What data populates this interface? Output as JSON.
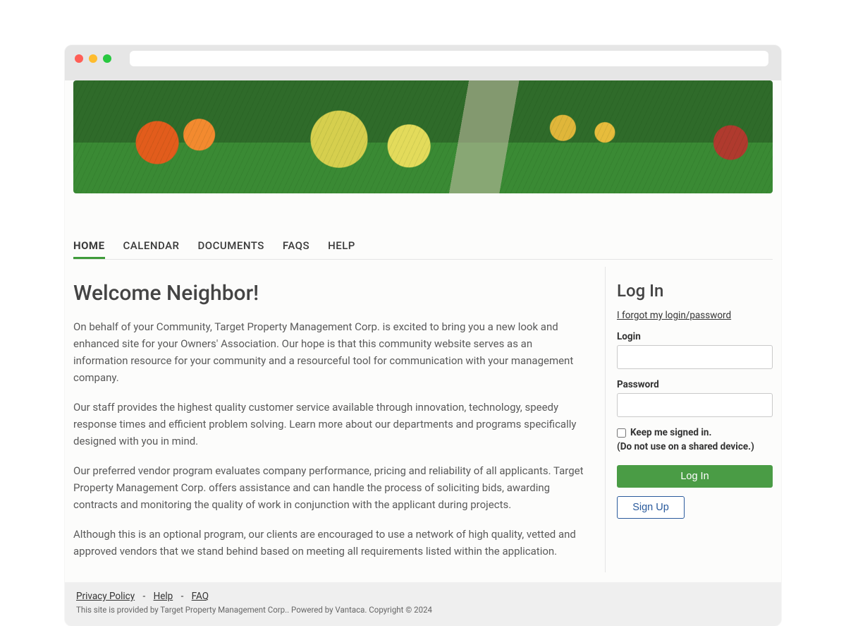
{
  "nav": {
    "items": [
      {
        "label": "HOME",
        "active": true
      },
      {
        "label": "CALENDAR",
        "active": false
      },
      {
        "label": "DOCUMENTS",
        "active": false
      },
      {
        "label": "FAQS",
        "active": false
      },
      {
        "label": "HELP",
        "active": false
      }
    ]
  },
  "main": {
    "heading": "Welcome Neighbor!",
    "paragraphs": [
      "On behalf of your Community, Target Property Management Corp. is excited to bring you a new look and enhanced site for your Owners' Association. Our hope is that this community website serves as an information resource for your community and a resourceful tool for communication with your management company.",
      "Our staff provides the highest quality customer service available through innovation, technology, speedy response times and efficient problem solving. Learn more about our departments and programs specifically designed with you in mind.",
      "Our preferred vendor program evaluates company performance, pricing and reliability of all applicants. Target Property Management Corp. offers assistance and can handle the process of soliciting bids, awarding contracts and monitoring the quality of work in conjunction with the applicant during projects.",
      "Although this is an optional program, our clients are encouraged to use a network of high quality, vetted and approved vendors that we stand behind based on meeting all requirements listed within the application."
    ]
  },
  "login": {
    "title": "Log In",
    "forgot": "I forgot my login/password",
    "login_label": "Login",
    "password_label": "Password",
    "keep_signed_in": "Keep me signed in.",
    "shared_warning": "(Do not use on a shared device.)",
    "login_button": "Log In",
    "signup_button": "Sign Up"
  },
  "footer": {
    "links": [
      {
        "label": "Privacy Policy"
      },
      {
        "label": "Help"
      },
      {
        "label": "FAQ"
      }
    ],
    "separator": "-",
    "note": "This site is provided by Target Property Management Corp.. Powered by Vantaca. Copyright © 2024"
  }
}
